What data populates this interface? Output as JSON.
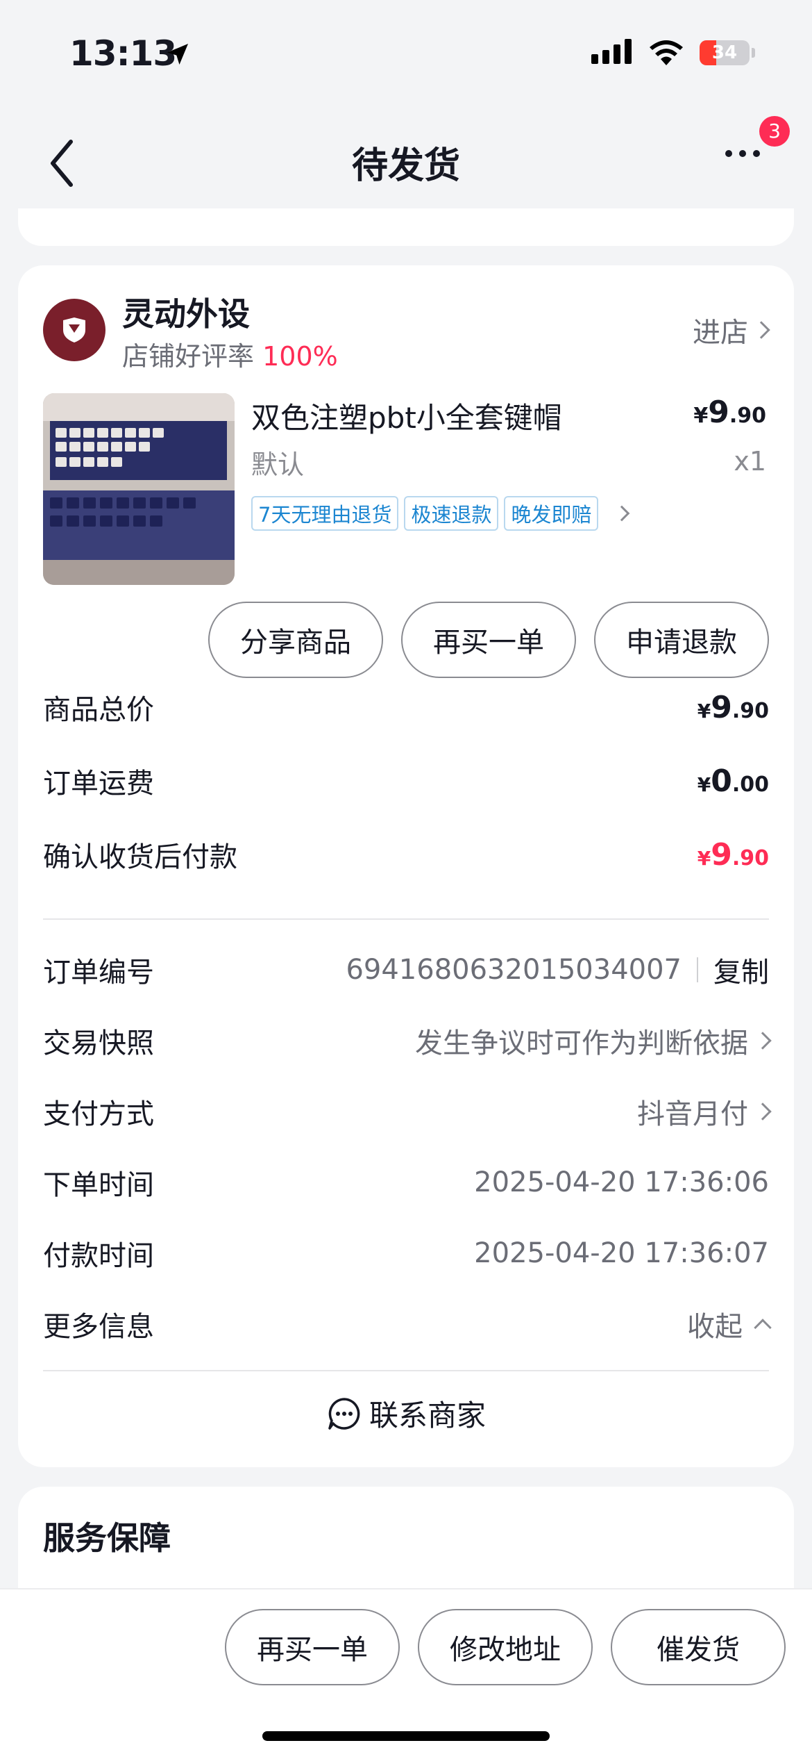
{
  "status_bar": {
    "time": "13:13",
    "battery": "34"
  },
  "nav": {
    "title": "待发货",
    "badge_count": "3"
  },
  "shop": {
    "name": "灵动外设",
    "rating_label": "店铺好评率",
    "rating_value": "100%",
    "enter_label": "进店"
  },
  "product": {
    "name": "双色注塑pbt小全套键帽",
    "spec": "默认",
    "price_symbol": "¥",
    "price_int": "9",
    "price_dec": ".90",
    "qty": "x1",
    "tags": [
      "7天无理由退货",
      "极速退款",
      "晚发即赔"
    ]
  },
  "actions": {
    "share": "分享商品",
    "rebuy": "再买一单",
    "refund": "申请退款"
  },
  "summary": [
    {
      "label": "商品总价",
      "symbol": "¥",
      "int": "9",
      "dec": ".90"
    },
    {
      "label": "订单运费",
      "symbol": "¥",
      "int": "0",
      "dec": ".00"
    },
    {
      "label": "确认收货后付款",
      "symbol": "¥",
      "int": "9",
      "dec": ".90"
    }
  ],
  "order_info": {
    "order_no_label": "订单编号",
    "order_no": "6941680632015034007",
    "copy_label": "复制",
    "snapshot_label": "交易快照",
    "snapshot_value": "发生争议时可作为判断依据",
    "payment_label": "支付方式",
    "payment_value": "抖音月付",
    "order_time_label": "下单时间",
    "order_time": "2025-04-20 17:36:06",
    "pay_time_label": "付款时间",
    "pay_time": "2025-04-20 17:36:07",
    "more_label": "更多信息",
    "collapse_label": "收起"
  },
  "contact_label": "联系商家",
  "service": {
    "title": "服务保障"
  },
  "bottom": {
    "rebuy": "再买一单",
    "modify_address": "修改地址",
    "urge": "催发货"
  },
  "colors": {
    "accent": "#fe2c55",
    "tag_blue": "#1c86d1",
    "shop_logo": "#7a1f2b"
  }
}
